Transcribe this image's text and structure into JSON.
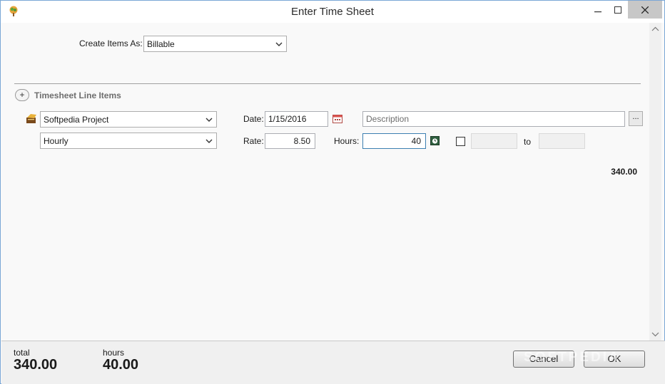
{
  "window": {
    "title": "Enter Time Sheet"
  },
  "form": {
    "create_items_label": "Create Items As:",
    "create_items_value": "Billable",
    "section_title": "Timesheet Line Items",
    "add_button": "+"
  },
  "line_item": {
    "project": "Softpedia Project",
    "rate_type": "Hourly",
    "date_label": "Date:",
    "date_value": "1/15/2016",
    "description_placeholder": "Description",
    "browse_label": "...",
    "rate_label": "Rate:",
    "rate_value": "8.50",
    "hours_label": "Hours:",
    "hours_value": "40",
    "to_label": "to",
    "line_total": "340.00"
  },
  "footer": {
    "total_caption": "total",
    "total_value": "340.00",
    "hours_caption": "hours",
    "hours_value": "40.00",
    "cancel_label": "Cancel",
    "ok_label": "OK"
  },
  "watermark": "SOFTPEDIA",
  "colors": {
    "accent_border": "#7aa7d6",
    "focus_border": "#3c7fb1",
    "calendar_red": "#d9534f"
  },
  "icons": {
    "app": "money-tree-icon",
    "project": "project-folder-icon",
    "date_picker": "calendar-icon",
    "timer": "stopwatch-icon",
    "dropdown": "chevron-down-icon"
  }
}
